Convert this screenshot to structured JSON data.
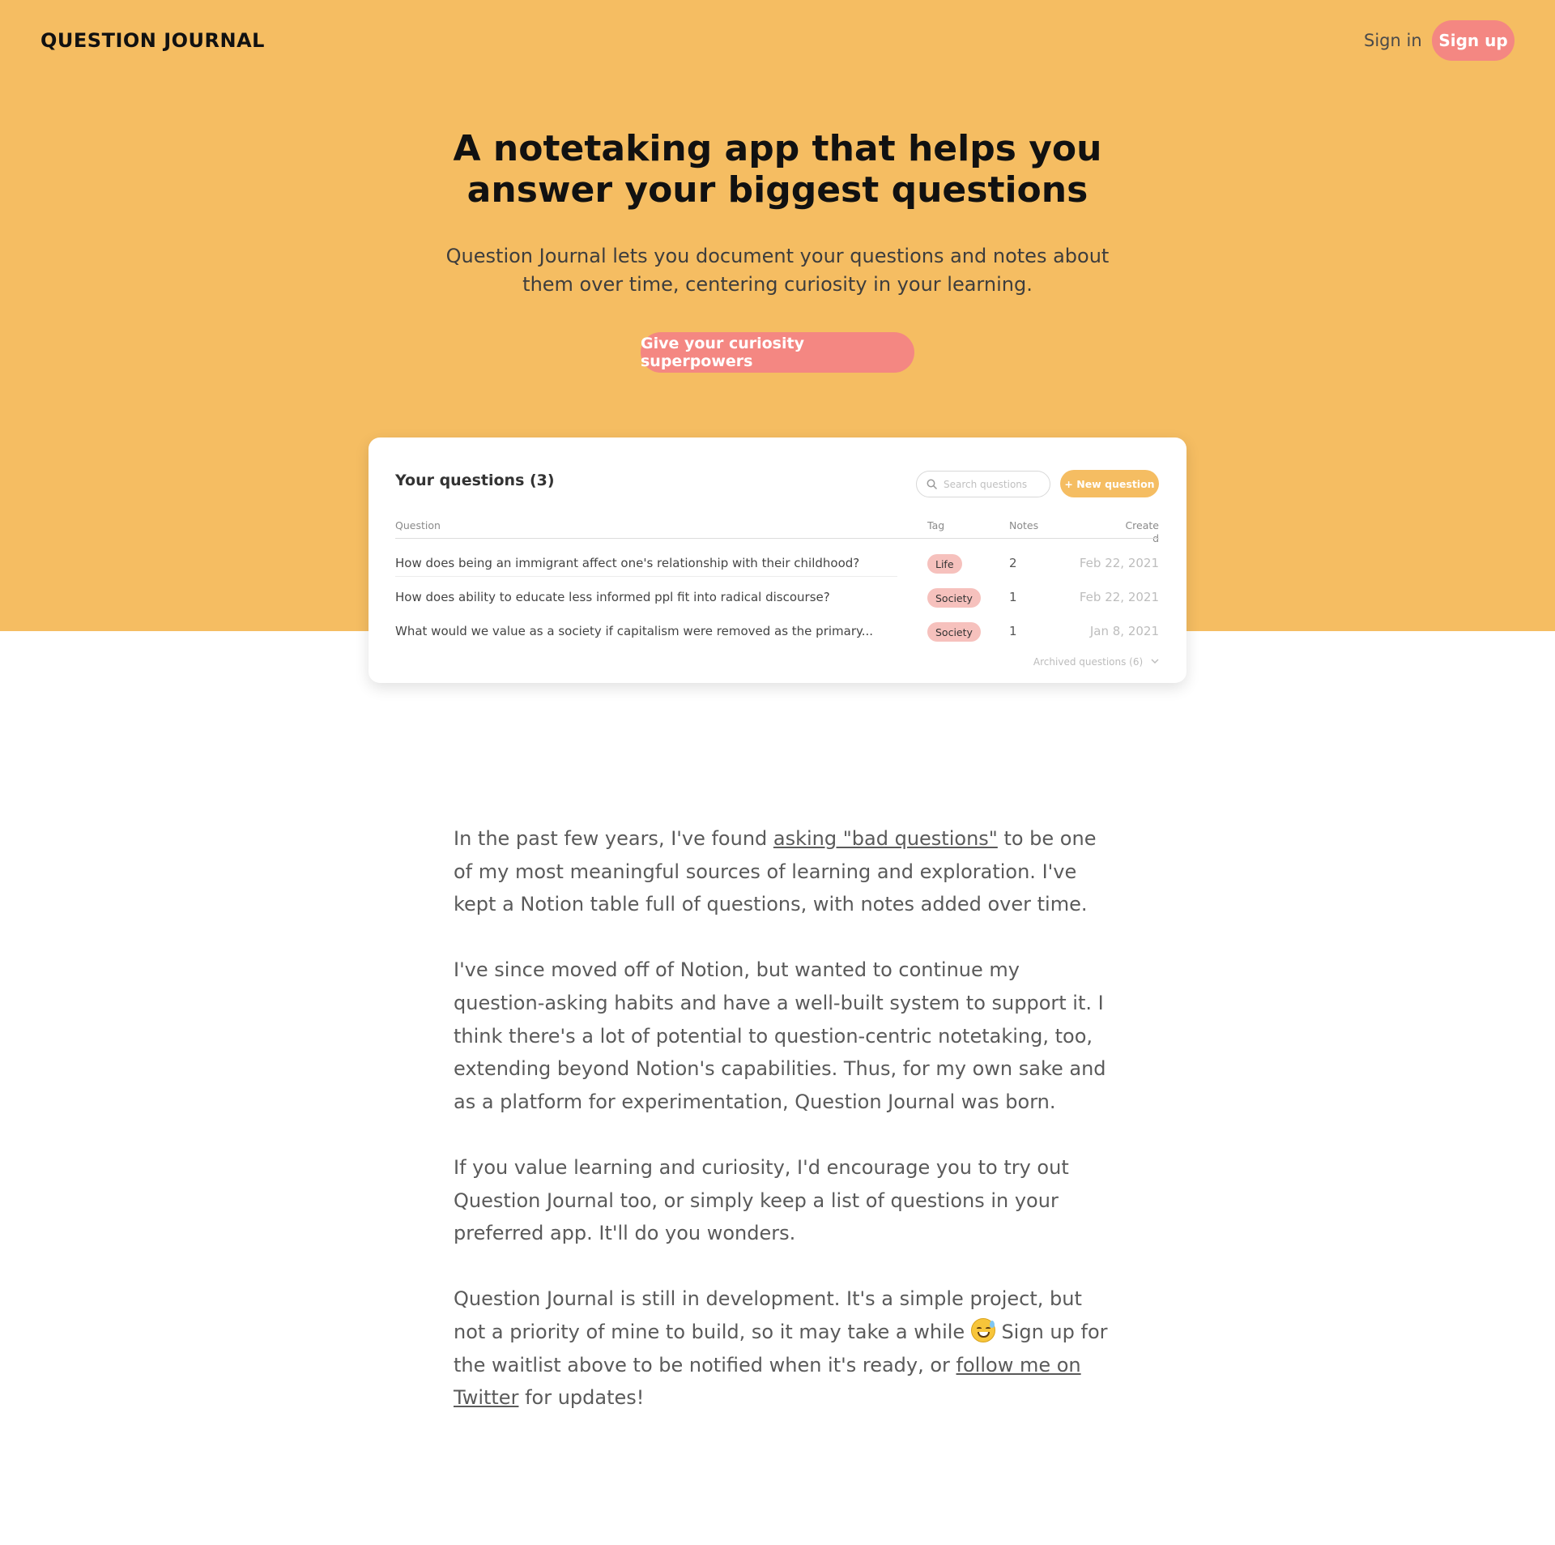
{
  "header": {
    "logo": "QUESTION JOURNAL",
    "sign_in": "Sign in",
    "sign_up": "Sign up"
  },
  "hero": {
    "headline_line1": "A notetaking app that helps you",
    "headline_line2": "answer your biggest questions",
    "subhead_line1": "Question Journal lets you document your questions and notes about",
    "subhead_line2": "them over time, centering curiosity in your learning.",
    "cta": "Give your curiosity superpowers",
    "background_color": "#f5bd62",
    "accent_color": "#f48782"
  },
  "app_preview": {
    "title": "Your questions (3)",
    "search_placeholder": "Search questions",
    "new_question": "+ New question",
    "columns": {
      "question": "Question",
      "tag": "Tag",
      "notes": "Notes",
      "created_line1": "Create",
      "created_line2": "d"
    },
    "rows": [
      {
        "question": "How does being an immigrant affect one's relationship with their childhood?",
        "tag": "Life",
        "notes": "2",
        "created": "Feb 22, 2021"
      },
      {
        "question": "How does ability to educate less informed ppl fit into radical discourse?",
        "tag": "Society",
        "notes": "1",
        "created": "Feb 22, 2021"
      },
      {
        "question": "What would we value as a society if capitalism were removed as the primary...",
        "tag": "Society",
        "notes": "1",
        "created": "Jan 8, 2021"
      }
    ],
    "archived": "Archived questions (6)"
  },
  "story": {
    "p1_before": "In the past few years, I've found ",
    "p1_link": "asking \"bad questions\"",
    "p1_after": " to be one of my most meaningful sources of learning and exploration. I've kept a Notion table full of questions, with notes added over time.",
    "p2": "I've since moved off of Notion, but wanted to continue my question-asking habits and have a well-built system to support it. I think there's a lot of potential to question-centric notetaking, too, extending beyond Notion's capabilities. Thus, for my own sake and as a platform for experimentation, Question Journal was born.",
    "p3": "If you value learning and curiosity, I'd encourage you to try out Question Journal too, or simply keep a list of questions in your preferred app. It'll do you wonders.",
    "p4_before": "Question Journal is still in development. It's a simple project, but not a priority of mine to build, so it may take a while ",
    "p4_emoji": "grinning-sweat-emoji",
    "p4_middle": " Sign up for the waitlist above to be notified when it's ready, or ",
    "p4_link": "follow me on Twitter",
    "p4_after": " for updates!"
  }
}
